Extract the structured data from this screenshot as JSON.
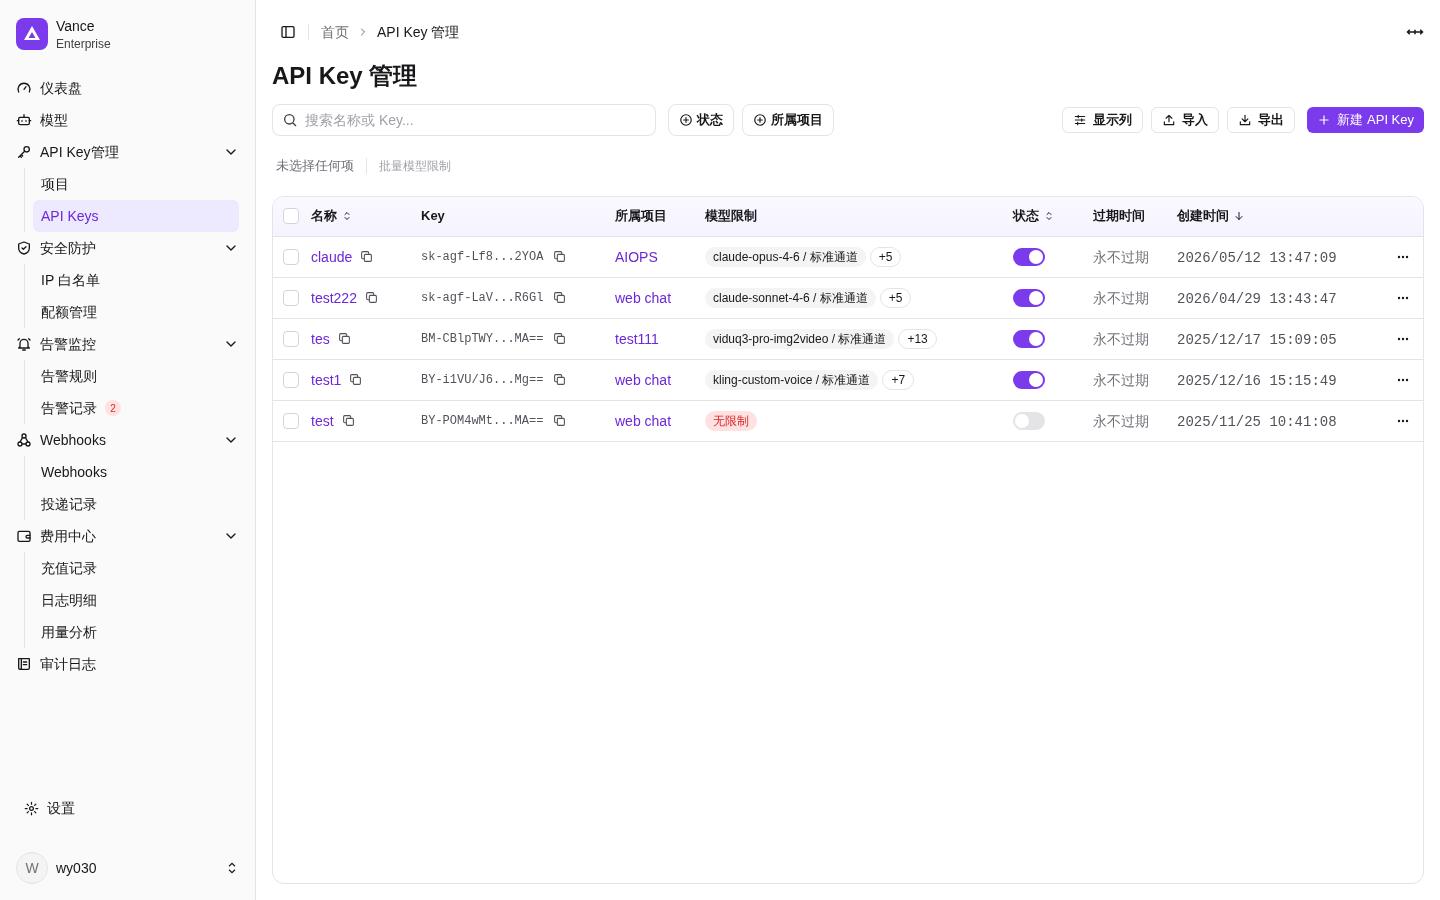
{
  "brand": {
    "name": "Vance",
    "subtitle": "Enterprise"
  },
  "nav": [
    {
      "label": "仪表盘"
    },
    {
      "label": "模型"
    },
    {
      "label": "API Key管理",
      "expanded": true,
      "children": [
        {
          "label": "项目",
          "selected": false
        },
        {
          "label": "API Keys",
          "selected": true
        }
      ]
    },
    {
      "label": "安全防护",
      "expanded": true,
      "children": [
        {
          "label": "IP 白名单",
          "selected": false
        },
        {
          "label": "配额管理",
          "selected": false
        }
      ]
    },
    {
      "label": "告警监控",
      "expanded": true,
      "children": [
        {
          "label": "告警规则",
          "selected": false
        },
        {
          "label": "告警记录",
          "selected": false,
          "badge": "2"
        }
      ]
    },
    {
      "label": "Webhooks",
      "expanded": true,
      "children": [
        {
          "label": "Webhooks",
          "selected": false
        },
        {
          "label": "投递记录",
          "selected": false
        }
      ]
    },
    {
      "label": "费用中心",
      "expanded": true,
      "children": [
        {
          "label": "充值记录",
          "selected": false
        },
        {
          "label": "日志明细",
          "selected": false
        },
        {
          "label": "用量分析",
          "selected": false
        }
      ]
    },
    {
      "label": "审计日志"
    }
  ],
  "settings": "设置",
  "user": {
    "initial": "W",
    "name": "wy030"
  },
  "breadcrumb": [
    "首页",
    "API Key 管理"
  ],
  "title": "API Key 管理",
  "search": {
    "placeholder": "搜索名称或 Key..."
  },
  "filters": [
    "状态",
    "所属项目"
  ],
  "actions": [
    {
      "label": "显示列",
      "kind": "columns"
    },
    {
      "label": "导入",
      "kind": "import"
    },
    {
      "label": "导出",
      "kind": "export"
    },
    {
      "label": "新建 API Key",
      "kind": "create"
    }
  ],
  "selection": {
    "label": "未选择任何项",
    "batch": "批量模型限制"
  },
  "table": {
    "all_checked": false,
    "columns": [
      {
        "label": "名称",
        "kind": "sortable"
      },
      {
        "label": "Key",
        "kind": "plain"
      },
      {
        "label": "所属项目",
        "kind": "plain"
      },
      {
        "label": "模型限制",
        "kind": "plain"
      },
      {
        "label": "状态",
        "kind": "sortable"
      },
      {
        "label": "过期时间",
        "kind": "plain"
      },
      {
        "label": "创建时间",
        "kind": "sorted"
      }
    ],
    "rows": [
      {
        "checked": false,
        "name": "claude",
        "key": "sk-agf-Lf8...2YOA",
        "project": "AIOPS",
        "model": {
          "kind": "list",
          "tag": "claude-opus-4-6 / 标准通道",
          "more": "+5"
        },
        "enabled": true,
        "expiry": "永不过期",
        "created": "2026/05/12 13:47:09"
      },
      {
        "checked": false,
        "name": "test222",
        "key": "sk-agf-LaV...R6Gl",
        "project": "web chat",
        "model": {
          "kind": "list",
          "tag": "claude-sonnet-4-6 / 标准通道",
          "more": "+5"
        },
        "enabled": true,
        "expiry": "永不过期",
        "created": "2026/04/29 13:43:47"
      },
      {
        "checked": false,
        "name": "tes",
        "key": "BM-CBlpTWY...MA==",
        "project": "test111",
        "model": {
          "kind": "list",
          "tag": "viduq3-pro-img2video / 标准通道",
          "more": "+13"
        },
        "enabled": true,
        "expiry": "永不过期",
        "created": "2025/12/17 15:09:05"
      },
      {
        "checked": false,
        "name": "test1",
        "key": "BY-i1VU/J6...Mg==",
        "project": "web chat",
        "model": {
          "kind": "list",
          "tag": "kling-custom-voice / 标准通道",
          "more": "+7"
        },
        "enabled": true,
        "expiry": "永不过期",
        "created": "2025/12/16 15:15:49"
      },
      {
        "checked": false,
        "name": "test",
        "key": "BY-POM4wMt...MA==",
        "project": "web chat",
        "model": {
          "kind": "unlimited",
          "tag": "无限制"
        },
        "enabled": false,
        "expiry": "永不过期",
        "created": "2025/11/25 10:41:08"
      }
    ]
  }
}
